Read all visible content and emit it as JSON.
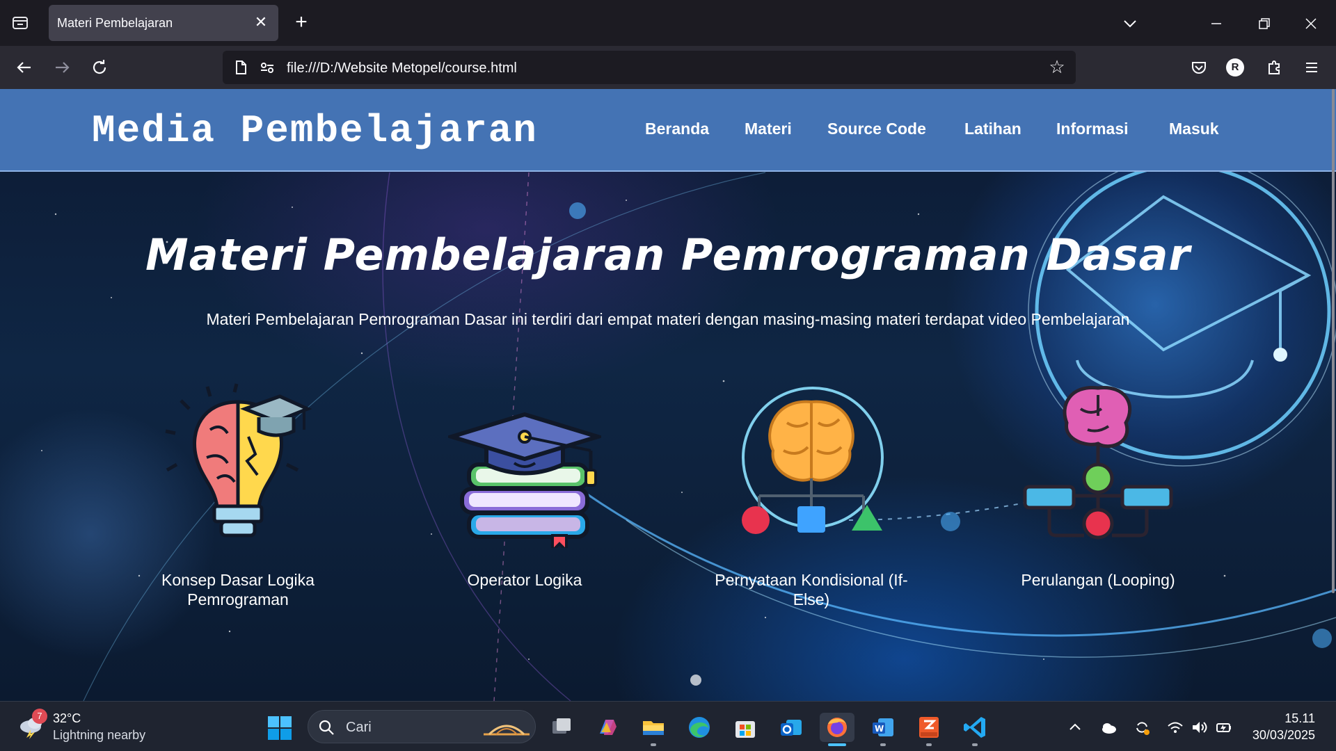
{
  "browser": {
    "tab_title": "Materi Pembelajaran",
    "url": "file:///D:/Website Metopel/course.html",
    "profile_initial": "R"
  },
  "site": {
    "brand": "Media Pembelajaran",
    "menu": [
      "Beranda",
      "Materi",
      "Source Code",
      "Latihan",
      "Informasi",
      "Masuk"
    ],
    "header_color": "#4473b4"
  },
  "hero": {
    "title": "Materi Pembelajaran Pemrograman Dasar",
    "subtitle": "Materi Pembelajaran Pemrograman Dasar ini terdiri dari empat materi dengan masing-masing materi terdapat video Pembelajaran"
  },
  "courses": [
    {
      "label": "Konsep Dasar Logika Pemrograman",
      "icon": "brain-lightbulb-icon"
    },
    {
      "label": "Operator Logika",
      "icon": "graduation-books-icon"
    },
    {
      "label": "Pernyataan Kondisional (If-Else)",
      "icon": "brain-shapes-icon"
    },
    {
      "label": "Perulangan (Looping)",
      "icon": "brain-flowchart-icon"
    }
  ],
  "taskbar": {
    "weather_temp": "32°C",
    "weather_desc": "Lightning nearby",
    "weather_badge": "7",
    "search_placeholder": "Cari",
    "time": "15.11",
    "date": "30/03/2025"
  }
}
